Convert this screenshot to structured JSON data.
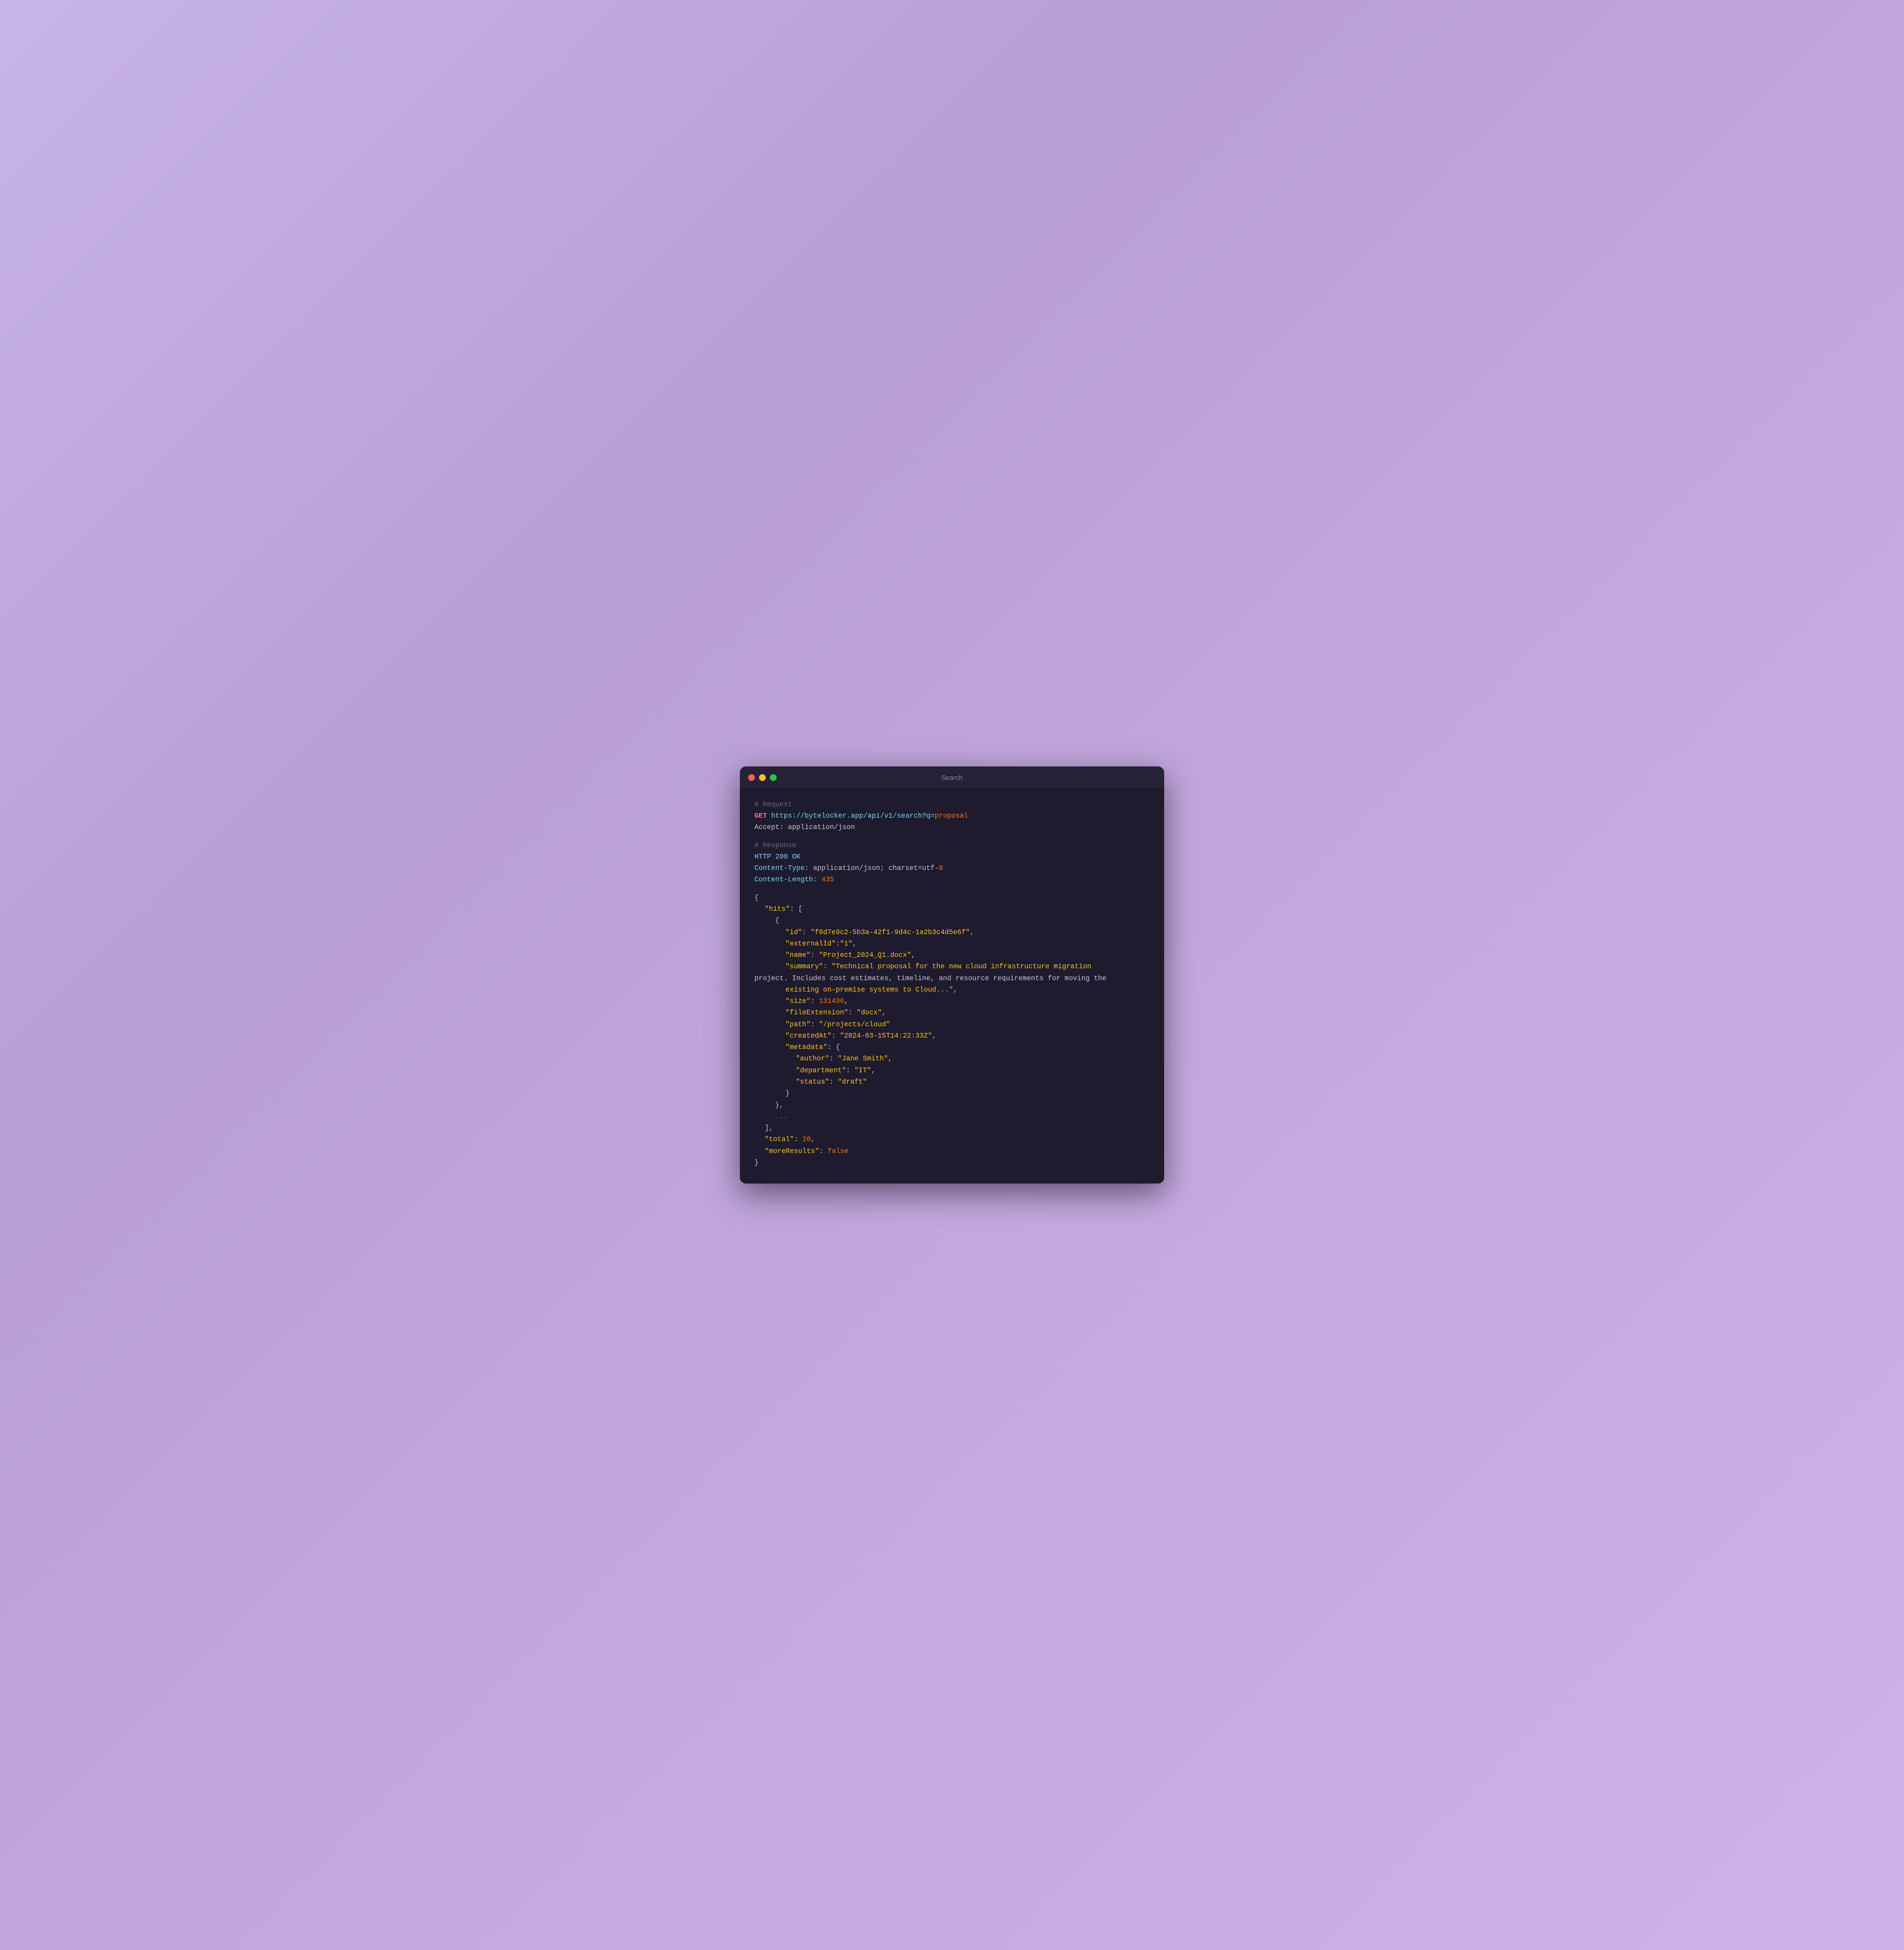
{
  "window": {
    "title": "Search",
    "dots": [
      "red",
      "yellow",
      "green"
    ]
  },
  "code": {
    "request_comment": "# Request",
    "get_method": "GET",
    "url_base": " https://bytelocker.app/api/v1/search?q",
    "url_eq": "=",
    "url_param": "proposal",
    "accept_header": "Accept: application/json",
    "response_comment": "# Response",
    "http_status": "HTTP 200 OK",
    "content_type_key": "Content-Type",
    "content_type_val": ": application/json; charset=utf-",
    "content_type_num": "8",
    "content_length_key": "Content-Length",
    "content_length_val": ": ",
    "content_length_num": "435",
    "hits_key": "\"hits\"",
    "id_key": "\"id\"",
    "id_val": "\"f8d7e9c2-5b3a-42f1-9d4c-1a2b3c4d5e6f\"",
    "externalId_key": "\"externalId\"",
    "externalId_val": "\"1\"",
    "name_key": "\"name\"",
    "name_val": "\"Project_2024_Q1.docx\"",
    "summary_key": "\"summary\"",
    "summary_val1": "\"Technical proposal for the new cloud infrastructure migration",
    "summary_val2": "project. Includes cost estimates, timeline, and resource requirements for moving the",
    "summary_val3": "existing on-premise systems to Cloud...\"",
    "size_key": "\"size\"",
    "size_val": "131436",
    "fileExt_key": "\"fileExtension\"",
    "fileExt_val": "\"docx\"",
    "path_key": "\"path\"",
    "path_val": "\"/projects/cloud\"",
    "createdAt_key": "\"createdAt\"",
    "createdAt_val": "\"2024-03-15T14:22:33Z\"",
    "metadata_key": "\"metadata\"",
    "author_key": "\"author\"",
    "author_val": "\"Jane Smith\"",
    "department_key": "\"department\"",
    "department_val": "\"IT\"",
    "status_key": "\"status\"",
    "status_val": "\"draft\"",
    "ellipsis": "...",
    "total_key": "\"total\"",
    "total_val": "20",
    "moreResults_key": "\"moreResults\"",
    "moreResults_val": "false"
  }
}
